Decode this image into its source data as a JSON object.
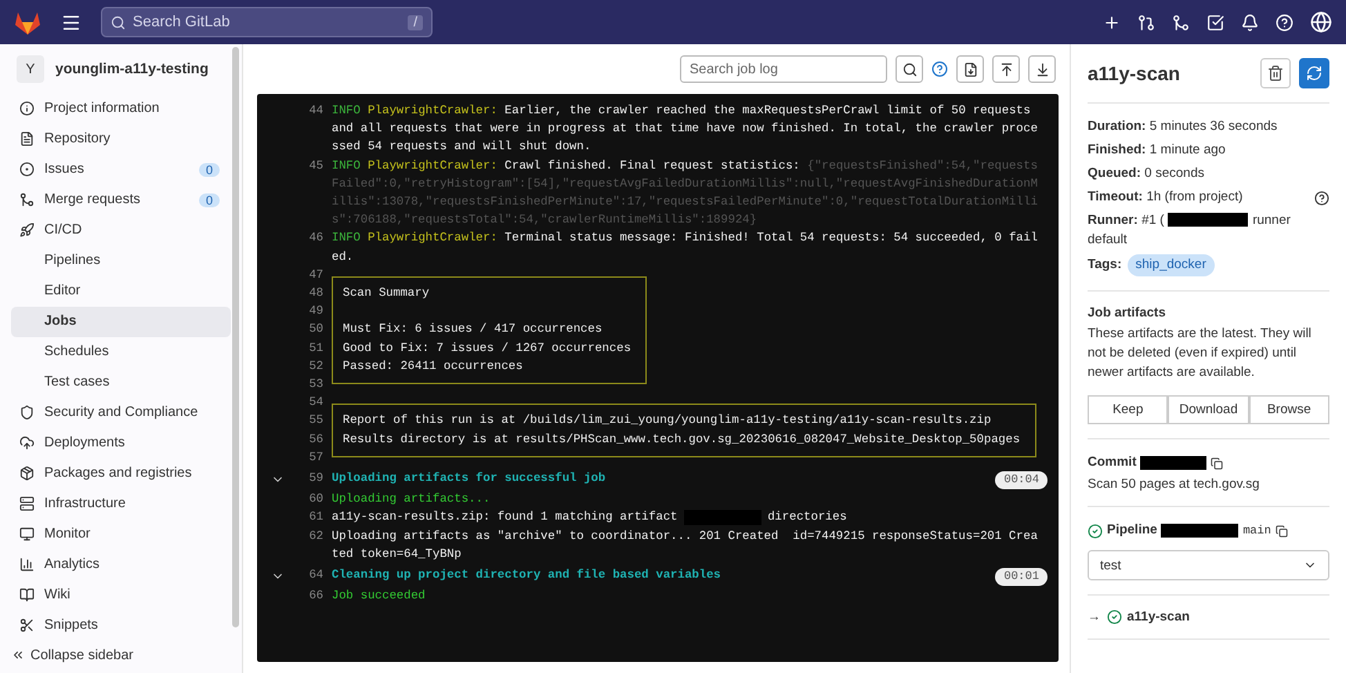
{
  "topbar": {
    "search_placeholder": "Search GitLab",
    "shortcut": "/"
  },
  "sidebar": {
    "avatar": "Y",
    "project": "younglim-a11y-testing",
    "items": [
      {
        "kind": "item",
        "label": "Project information",
        "selected": false
      },
      {
        "kind": "item",
        "label": "Repository",
        "selected": false
      },
      {
        "kind": "item",
        "label": "Issues",
        "badge": "0",
        "selected": false
      },
      {
        "kind": "item",
        "label": "Merge requests",
        "badge": "0",
        "selected": false
      },
      {
        "kind": "item",
        "label": "CI/CD",
        "selected": false
      },
      {
        "kind": "sub",
        "label": "Pipelines",
        "selected": false
      },
      {
        "kind": "sub",
        "label": "Editor",
        "selected": false
      },
      {
        "kind": "sub",
        "label": "Jobs",
        "selected": true
      },
      {
        "kind": "sub",
        "label": "Schedules",
        "selected": false
      },
      {
        "kind": "sub",
        "label": "Test cases",
        "selected": false
      },
      {
        "kind": "item",
        "label": "Security and Compliance",
        "selected": false
      },
      {
        "kind": "item",
        "label": "Deployments",
        "selected": false
      },
      {
        "kind": "item",
        "label": "Packages and registries",
        "selected": false
      },
      {
        "kind": "item",
        "label": "Infrastructure",
        "selected": false
      },
      {
        "kind": "item",
        "label": "Monitor",
        "selected": false
      },
      {
        "kind": "item",
        "label": "Analytics",
        "selected": false
      },
      {
        "kind": "item",
        "label": "Wiki",
        "selected": false
      },
      {
        "kind": "item",
        "label": "Snippets",
        "selected": false
      }
    ],
    "collapse": "Collapse sidebar"
  },
  "log_toolbar": {
    "search_placeholder": "Search job log"
  },
  "log": [
    {
      "kind": "line",
      "num": "44",
      "parts": [
        {
          "kind": "info",
          "text": "INFO"
        },
        {
          "kind": "source",
          "text": "PlaywrightCrawler:"
        },
        {
          "kind": "plain",
          "text": "Earlier, the crawler reached the maxRequestsPerCrawl limit of 50 requests and all requests that were in progress at that time have now finished. In total, the crawler processed 54 requests and will shut down."
        }
      ]
    },
    {
      "kind": "line",
      "num": "45",
      "parts": [
        {
          "kind": "info",
          "text": "INFO"
        },
        {
          "kind": "source",
          "text": "PlaywrightCrawler:"
        },
        {
          "kind": "plain",
          "text": "Crawl finished. Final request statistics:"
        },
        {
          "kind": "muted",
          "text": "{\"requestsFinished\":54,\"requestsFailed\":0,\"retryHistogram\":[54],\"requestAvgFailedDurationMillis\":null,\"requestAvgFinishedDurationMillis\":13078,\"requestsFinishedPerMinute\":17,\"requestsFailedPerMinute\":0,\"requestTotalDurationMillis\":706188,\"requestsTotal\":54,\"crawlerRuntimeMillis\":189924}"
        }
      ]
    },
    {
      "kind": "line",
      "num": "46",
      "parts": [
        {
          "kind": "info",
          "text": "INFO"
        },
        {
          "kind": "source",
          "text": "PlaywrightCrawler:"
        },
        {
          "kind": "plain",
          "text": "Terminal status message: Finished! Total 54 requests: 54 succeeded, 0 failed."
        }
      ]
    },
    {
      "kind": "box",
      "lines": [
        {
          "num": "47"
        },
        {
          "num": "48",
          "text": "Scan Summary"
        },
        {
          "num": "49"
        },
        {
          "num": "50",
          "text": "Must Fix: 6 issues / 417 occurrences"
        },
        {
          "num": "51",
          "text": "Good to Fix: 7 issues / 1267 occurrences"
        },
        {
          "num": "52",
          "text": "Passed: 26411 occurrences"
        },
        {
          "num": "53"
        }
      ]
    },
    {
      "kind": "box",
      "lines": [
        {
          "num": "54"
        },
        {
          "num": "55",
          "text": "Report of this run is at /builds/lim_zui_young/younglim-a11y-testing/a11y-scan-results.zip"
        },
        {
          "num": "56",
          "text": "Results directory is at results/PHScan_www.tech.gov.sg_20230616_082047_Website_Desktop_50pages"
        },
        {
          "num": "57"
        }
      ]
    },
    {
      "kind": "section",
      "num": "59",
      "text": "Uploading artifacts for successful job",
      "duration": "00:04"
    },
    {
      "kind": "line",
      "num": "60",
      "parts": [
        {
          "kind": "success",
          "text": "Uploading artifacts..."
        }
      ]
    },
    {
      "kind": "line",
      "num": "61",
      "parts": [
        {
          "kind": "plain",
          "text": "a11y-scan-results.zip: found 1 matching artifact"
        },
        {
          "kind": "redacted"
        },
        {
          "kind": "plain",
          "text": "directories"
        }
      ]
    },
    {
      "kind": "line",
      "num": "62",
      "parts": [
        {
          "kind": "plain",
          "text": "Uploading artifacts as \"archive\" to coordinator... 201 Created  id=7449215 responseStatus=201 Created token=64_TyBNp"
        }
      ]
    },
    {
      "kind": "section",
      "num": "64",
      "text": "Cleaning up project directory and file based variables",
      "duration": "00:01"
    },
    {
      "kind": "line",
      "num": "66",
      "parts": [
        {
          "kind": "success",
          "text": "Job succeeded"
        }
      ]
    }
  ],
  "job": {
    "title": "a11y-scan",
    "details": [
      {
        "label": "Duration:",
        "value": "5 minutes 36 seconds"
      },
      {
        "label": "Finished:",
        "value": "1 minute ago"
      },
      {
        "label": "Queued:",
        "value": "0 seconds"
      },
      {
        "label": "Timeout:",
        "value": "1h (from project)"
      }
    ],
    "runner": {
      "label": "Runner:",
      "value": "#1 (",
      "after": "runner default"
    },
    "tags_label": "Tags:",
    "tags": [
      "ship_docker"
    ],
    "artifacts": {
      "title": "Job artifacts",
      "text": "These artifacts are the latest. They will not be deleted (even if expired) until newer artifacts are available.",
      "buttons": [
        "Keep",
        "Download",
        "Browse"
      ]
    },
    "commit": {
      "label": "Commit",
      "message": "Scan 50 pages at tech.gov.sg"
    },
    "pipeline": {
      "label": "Pipeline",
      "branch": "main",
      "stage": "test"
    },
    "arrow": "→",
    "related_job": "a11y-scan"
  }
}
